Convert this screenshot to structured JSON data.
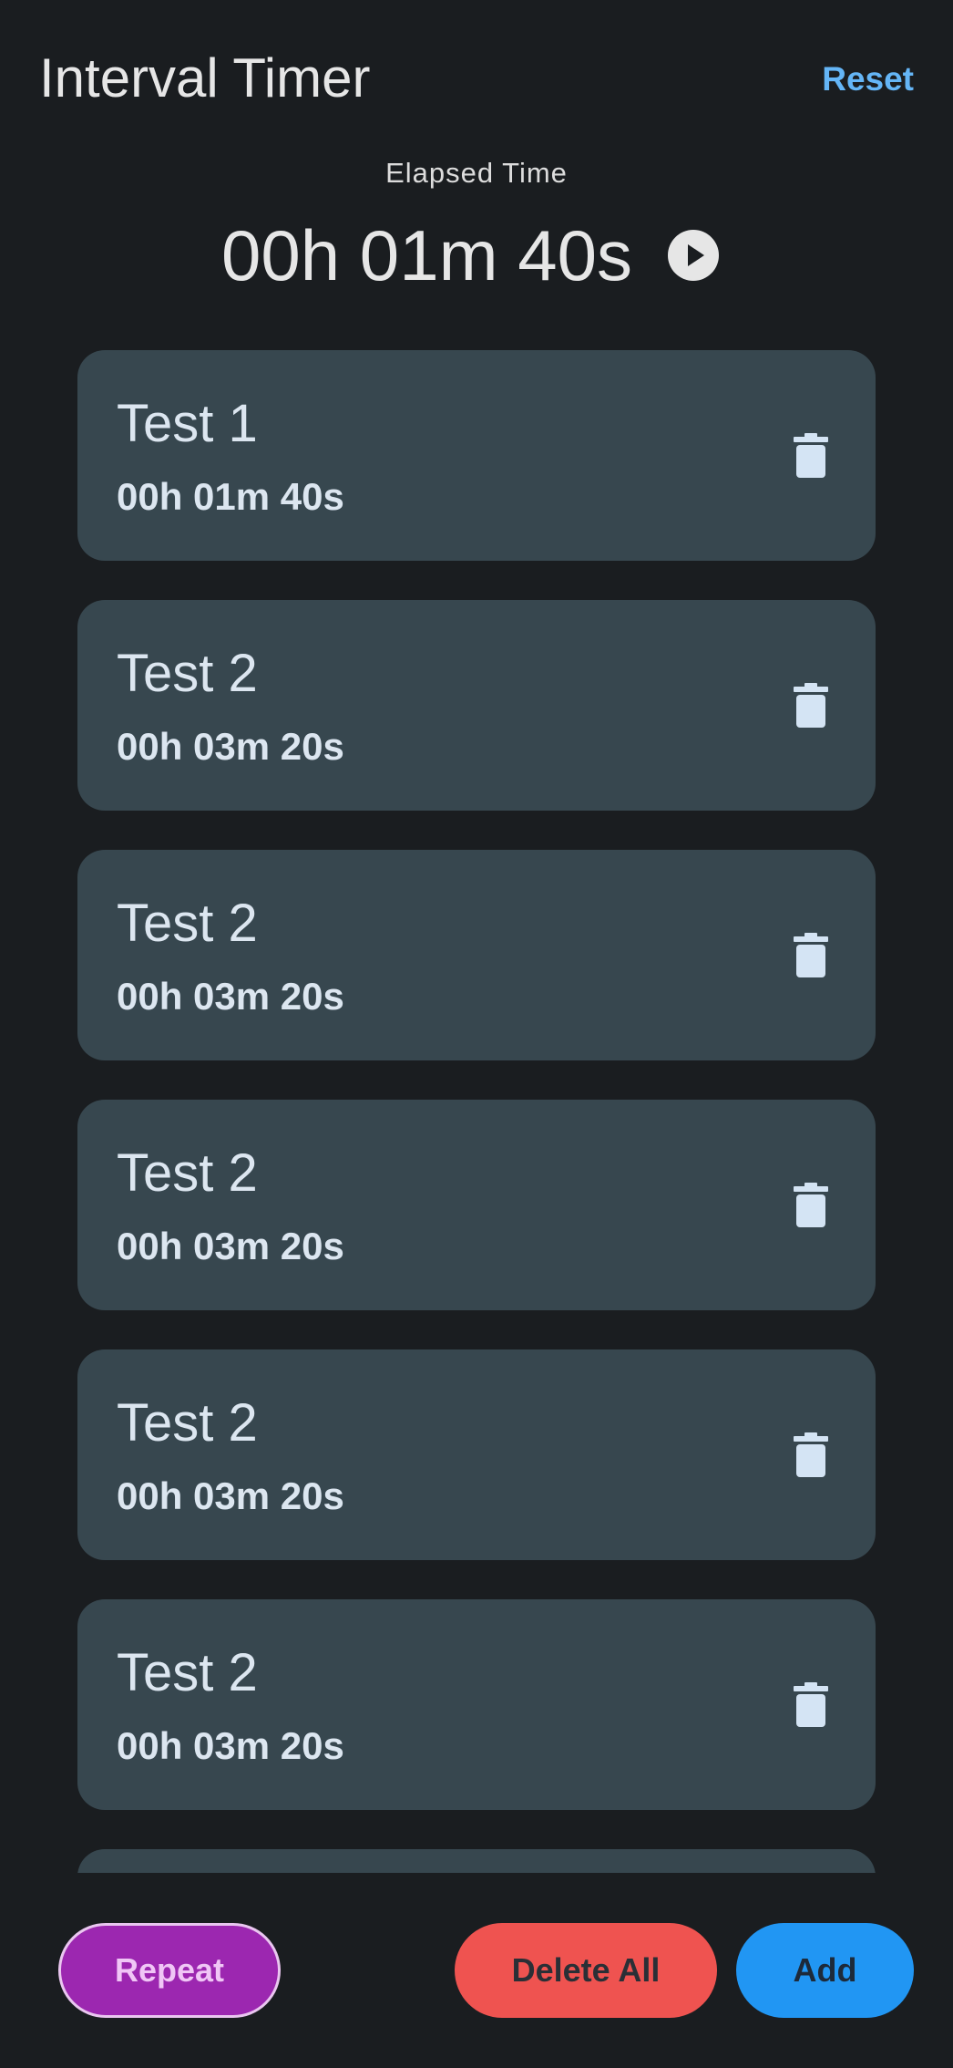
{
  "header": {
    "title": "Interval Timer",
    "reset_label": "Reset"
  },
  "timer": {
    "elapsed_label": "Elapsed Time",
    "elapsed_value": "00h 01m 40s",
    "play_icon": "play-circle-icon"
  },
  "intervals": [
    {
      "name": "Test 1",
      "duration": "00h 01m 40s"
    },
    {
      "name": "Test 2",
      "duration": "00h 03m 20s"
    },
    {
      "name": "Test 2",
      "duration": "00h 03m 20s"
    },
    {
      "name": "Test 2",
      "duration": "00h 03m 20s"
    },
    {
      "name": "Test 2",
      "duration": "00h 03m 20s"
    },
    {
      "name": "Test 2",
      "duration": "00h 03m 20s"
    },
    {
      "name": "",
      "duration": ""
    }
  ],
  "actions": {
    "repeat_label": "Repeat",
    "delete_all_label": "Delete All",
    "add_label": "Add"
  },
  "colors": {
    "background": "#1a1d20",
    "card": "#37474f",
    "accent_link": "#64b5f6",
    "repeat": "#9c27b0",
    "delete_all": "#ef5350",
    "add": "#2196f3"
  }
}
